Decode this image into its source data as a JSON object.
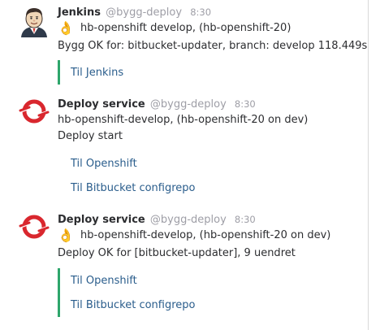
{
  "messages": [
    {
      "name": "Jenkins",
      "handle": "@bygg-deploy",
      "time": "8:30",
      "emoji": "👌",
      "lines": [
        "hb-openshift develop, (hb-openshift-20)",
        "Bygg OK for: bitbucket-updater, branch: develop 118.449s"
      ],
      "links": [
        "Til Jenkins"
      ],
      "avatar_icon": "jenkins-butler-icon"
    },
    {
      "name": "Deploy service",
      "handle": "@bygg-deploy",
      "time": "8:30",
      "lines": [
        "hb-openshift-develop, (hb-openshift-20 on dev)",
        "Deploy start"
      ],
      "links": [
        "Til Openshift",
        "Til Bitbucket configrepo"
      ],
      "avatar_icon": "openshift-logo-icon"
    },
    {
      "name": "Deploy service",
      "handle": "@bygg-deploy",
      "time": "8:30",
      "emoji": "👌",
      "lines": [
        "hb-openshift-develop, (hb-openshift-20 on dev)",
        "Deploy OK for [bitbucket-updater], 9 uendret"
      ],
      "links": [
        "Til Openshift",
        "Til Bitbucket configrepo"
      ],
      "avatar_icon": "openshift-logo-icon"
    }
  ],
  "colors": {
    "attachment_bar": "#2ea66b",
    "link": "#2a5d8c",
    "meta": "#9e9ea6",
    "text": "#2c2d30",
    "openshift_red": "#d9272e"
  }
}
